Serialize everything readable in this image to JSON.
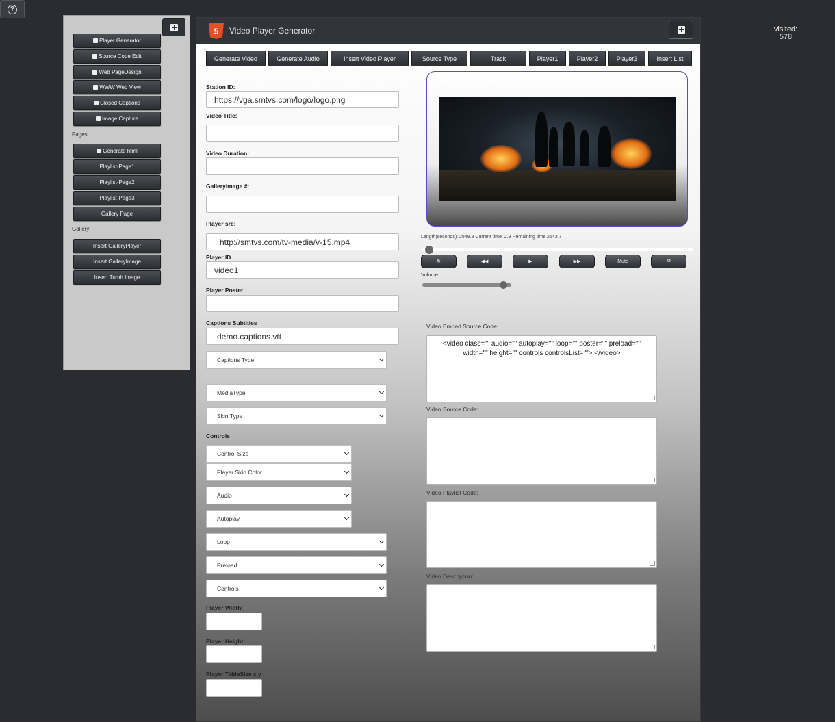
{
  "help": {
    "icon": "help-circle-icon"
  },
  "visited": {
    "label": "visited:",
    "count": "578"
  },
  "sidebar": {
    "title": "",
    "plus_icon": "plus-square-icon",
    "group1": [
      {
        "label": "Player Generator"
      },
      {
        "label": "Source Code Edit"
      },
      {
        "label": "Web PageDesign"
      },
      {
        "label": "WWW Web View"
      },
      {
        "label": "Closed Captions"
      },
      {
        "label": "Image Capture"
      }
    ],
    "pages_label": "Pages",
    "group2": [
      {
        "label": "Generate html"
      },
      {
        "label": "Playlist-Page1"
      },
      {
        "label": "Playlist-Page2"
      },
      {
        "label": "Playlist-Page3"
      },
      {
        "label": "Gallery Page"
      }
    ],
    "gallery_label": "Gallery",
    "group3": [
      {
        "label": "Insert GalleryPlayer"
      },
      {
        "label": "Insert GalleryImage"
      },
      {
        "label": "Insert Tumb Image"
      }
    ]
  },
  "panel": {
    "logo_text": "5",
    "title": "Video Player Generator",
    "tabs": [
      "Generate Video",
      "Generate Audio",
      "Insert Video Player",
      "Source Type",
      "Track",
      "Player1",
      "Player2",
      "Player3",
      "Insert List"
    ]
  },
  "form": {
    "station_id": {
      "label": "Station ID:",
      "value": "https://vga.smtvs.com/logo/logo.png"
    },
    "video_title": {
      "label": "Video Title:",
      "value": ""
    },
    "video_duration": {
      "label": "Video Duration:",
      "value": ""
    },
    "gallery_image": {
      "label": "Galleryimage #:",
      "value": ""
    },
    "player_src": {
      "label": "Player src:",
      "value": "http://smtvs.com/tv-media/v-15.mp4"
    },
    "player_id": {
      "label": "Player ID",
      "value": "video1"
    },
    "player_poster": {
      "label": "Player Poster",
      "value": ""
    },
    "captions": {
      "label": "Captions Subtitles",
      "value": "demo.captions.vtt"
    },
    "captions_type": "Captions Type",
    "media_type": "MediaType",
    "skin_type": "Skin Type",
    "controls_heading": "Controls",
    "control_size": "Control Size",
    "player_skin_color": "Player Skin Color",
    "audio": "Audio",
    "autoplay": "Autoplay",
    "loop": "Loop",
    "preload": "Preload",
    "controls": "Controls",
    "player_width": "Player Width:",
    "player_height": "Player Height:",
    "player_table_size": "Player TableSize x y :"
  },
  "player": {
    "time_text": "Length(seconds): 2548.8 Current time: 2.9 Remaining time 2543.7",
    "controls": [
      {
        "label": "",
        "icon": "replay-icon"
      },
      {
        "label": "",
        "icon": "rewind-icon"
      },
      {
        "label": "",
        "icon": "play-icon"
      },
      {
        "label": "",
        "icon": "fast-forward-icon"
      },
      {
        "label": "Mute",
        "icon": ""
      },
      {
        "label": "",
        "icon": "fullscreen-icon"
      }
    ],
    "seek_progress": 0.01,
    "volume_label": "Volume",
    "volume_level": 0.95
  },
  "code": {
    "embed_label": "Video Embad Source Code:",
    "embed_value": "<video class=\"\" audio=\"\" autoplay=\"\" loop=\"\" poster=\"\" preload=\"\" width=\"\" height=\"\" controls  controlsList=\"\"> </video>",
    "source_label": "Video Source Code:",
    "source_value": "",
    "playlist_label": "Video Playlist Code:",
    "playlist_value": "",
    "description_label": "Video Description:",
    "description_value": ""
  }
}
